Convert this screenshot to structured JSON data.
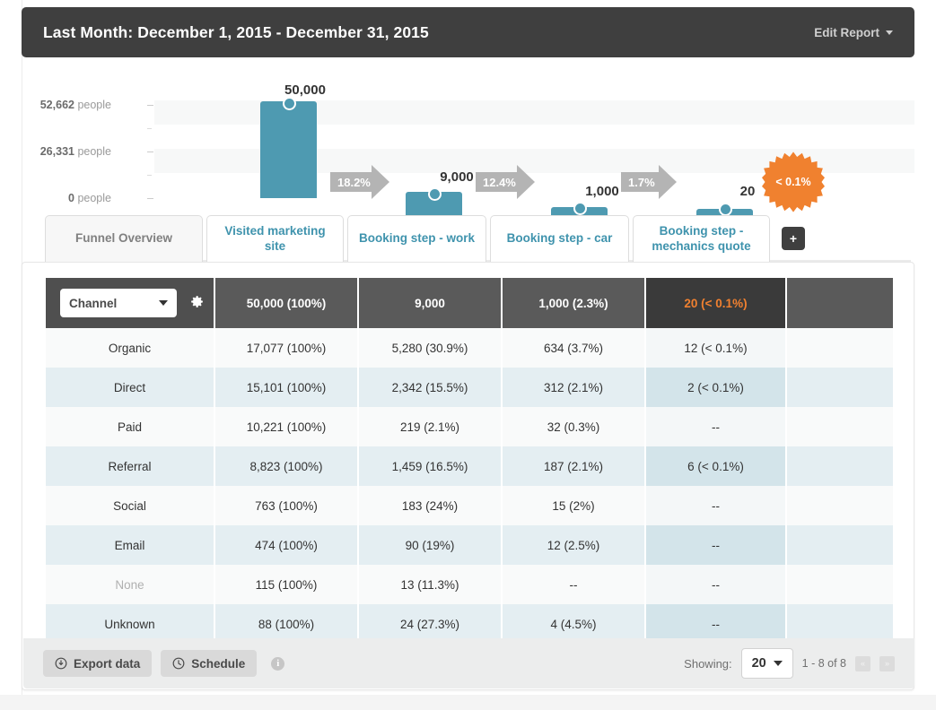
{
  "header": {
    "title": "Last Month: December 1, 2015 - December 31, 2015",
    "edit_report_label": "Edit Report",
    "caret_icon": "chevron-down-icon",
    "background": "#3f3f3f"
  },
  "chart_data": {
    "type": "bar",
    "title": "",
    "xlabel": "",
    "ylabel": "people",
    "ylim": [
      0,
      52662
    ],
    "grid": true,
    "categories": [
      "Visited marketing site",
      "Booking step - work",
      "Booking step - car",
      "Booking step - mechanics quote"
    ],
    "values": [
      50000,
      9000,
      1000,
      20
    ],
    "value_labels": [
      "50,000",
      "9,000",
      "1,000",
      "20"
    ],
    "ytick_labels": [
      "52,662 people",
      "26,331 people",
      "0 people"
    ],
    "ytick_values": [
      52662,
      26331,
      0
    ],
    "ytick_numbers": [
      "52,662",
      "26,331",
      "0"
    ],
    "ytick_unit": "people",
    "step_conversions": [
      "18.2%",
      "12.4%",
      "1.7%"
    ],
    "overall_conversion": "< 0.1%",
    "bar_color": "#4e9ab1",
    "arrow_color": "#b4b4b4",
    "badge_color": "#f0812f"
  },
  "tabs": [
    {
      "label": "Funnel Overview",
      "active": false,
      "style": "overview"
    },
    {
      "label": "Visited marketing site",
      "active": true,
      "style": "step"
    },
    {
      "label": "Booking step - work",
      "active": true,
      "style": "step"
    },
    {
      "label": "Booking step - car",
      "active": true,
      "style": "step"
    },
    {
      "label": "Booking step - mechanics quote",
      "active": true,
      "style": "step"
    }
  ],
  "add_tab_label": "+",
  "table": {
    "dimension_selector": {
      "value": "Channel",
      "caret_icon": "chevron-down-icon",
      "settings_icon": "gear-icon"
    },
    "headers": [
      "50,000 (100%)",
      "9,000",
      "1,000 (2.3%)",
      "20 (< 0.1%)"
    ],
    "highlighted_header_index": 3,
    "highlight_color": "#f08030",
    "rows": [
      {
        "dimension": "Organic",
        "muted": false,
        "cells": [
          "17,077 (100%)",
          "5,280 (30.9%)",
          "634 (3.7%)",
          "12 (< 0.1%)"
        ]
      },
      {
        "dimension": "Direct",
        "muted": false,
        "cells": [
          "15,101 (100%)",
          "2,342 (15.5%)",
          "312 (2.1%)",
          "2 (< 0.1%)"
        ]
      },
      {
        "dimension": "Paid",
        "muted": false,
        "cells": [
          "10,221 (100%)",
          "219 (2.1%)",
          "32 (0.3%)",
          "--"
        ]
      },
      {
        "dimension": "Referral",
        "muted": false,
        "cells": [
          "8,823 (100%)",
          "1,459 (16.5%)",
          "187 (2.1%)",
          "6 (< 0.1%)"
        ]
      },
      {
        "dimension": "Social",
        "muted": false,
        "cells": [
          "763 (100%)",
          "183 (24%)",
          "15 (2%)",
          "--"
        ]
      },
      {
        "dimension": "Email",
        "muted": false,
        "cells": [
          "474 (100%)",
          "90 (19%)",
          "12 (2.5%)",
          "--"
        ]
      },
      {
        "dimension": "None",
        "muted": true,
        "cells": [
          "115 (100%)",
          "13 (11.3%)",
          "--",
          "--"
        ]
      },
      {
        "dimension": "Unknown",
        "muted": false,
        "cells": [
          "88 (100%)",
          "24 (27.3%)",
          "4 (4.5%)",
          "--"
        ]
      }
    ]
  },
  "footer": {
    "export_label": "Export data",
    "export_icon": "download-circle-icon",
    "schedule_label": "Schedule",
    "schedule_icon": "clock-icon",
    "info_icon": "info-icon",
    "info_glyph": "i",
    "showing_label": "Showing:",
    "page_size": "20",
    "page_size_caret": "chevron-down-icon",
    "range_label": "1 - 8 of 8",
    "prev_glyph": "«",
    "next_glyph": "»"
  }
}
